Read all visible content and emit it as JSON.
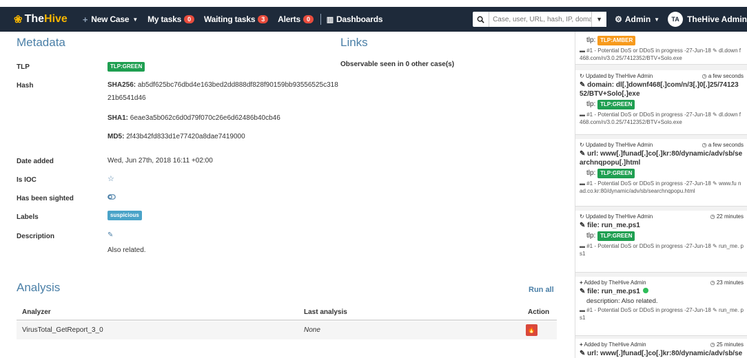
{
  "navbar": {
    "brand_prefix": "The",
    "brand_hive": "Hive",
    "new_case": "New Case",
    "my_tasks": "My tasks",
    "my_tasks_count": "0",
    "waiting_tasks": "Waiting tasks",
    "waiting_tasks_count": "3",
    "alerts": "Alerts",
    "alerts_count": "0",
    "dashboards": "Dashboards",
    "search_placeholder": "Case, user, URL, hash, IP, domain ...",
    "admin": "Admin",
    "avatar_initials": "TA",
    "user_name": "TheHive Admin"
  },
  "metadata": {
    "title": "Metadata",
    "tlp_label": "TLP",
    "tlp_value": "TLP:GREEN",
    "hash_label": "Hash",
    "sha256_label": "SHA256:",
    "sha256_value_1": "ab5df625bc76dbd4e163bed2dd888df828f90159bb93556525c318",
    "sha256_value_2": "21b6541d46",
    "sha1_label": "SHA1:",
    "sha1_value": "6eae3a5b062c6d0d79f070c26e6d62486b40cb46",
    "md5_label": "MD5:",
    "md5_value": "2f43b42fd833d1e77420a8dae7419000",
    "date_label": "Date added",
    "date_value": "Wed, Jun 27th, 2018 16:11 +02:00",
    "ioc_label": "Is IOC",
    "sighted_label": "Has been sighted",
    "labels_label": "Labels",
    "label_value": "suspicious",
    "description_label": "Description",
    "description_value": "Also related."
  },
  "links": {
    "title": "Links",
    "text": "Observable seen in 0 other case(s)"
  },
  "analysis": {
    "title": "Analysis",
    "run_all": "Run all",
    "col_analyzer": "Analyzer",
    "col_last": "Last analysis",
    "col_action": "Action",
    "rows": [
      {
        "analyzer": "VirusTotal_GetReport_3_0",
        "last": "None"
      }
    ]
  },
  "sidebar": {
    "cards": [
      {
        "tlp_prefix": "tlp:",
        "tlp": "TLP:AMBER",
        "case": "#1 - Potential DoS or DDoS in progress -27-Jun-18",
        "extra": "dl.down f468.com/n/3.0.25/7412352/BTV+Solo.exe"
      },
      {
        "head": "Updated by TheHive Admin",
        "time": "a few seconds",
        "title": "domain: dl[.]downf468[.]com/n/3[.]0[.]25/74123 52/BTV+Solo[.]exe",
        "tlp_prefix": "tlp:",
        "tlp": "TLP:GREEN",
        "case": "#1 - Potential DoS or DDoS in progress -27-Jun-18",
        "extra": "dl.down f468.com/n/3.0.25/7412352/BTV+Solo.exe"
      },
      {
        "head": "Updated by TheHive Admin",
        "time": "a few seconds",
        "title": "url: www[.]funad[.]co[.]kr:80/dynamic/adv/sb/se archnqpopu[.]html",
        "tlp_prefix": "tlp:",
        "tlp": "TLP:GREEN",
        "case": "#1 - Potential DoS or DDoS in progress -27-Jun-18",
        "extra": "www.fu nad.co.kr:80/dynamic/adv/sb/searchnqpopu.html"
      },
      {
        "head": "Updated by TheHive Admin",
        "time": "22 minutes",
        "title": "file: run_me.ps1",
        "tlp_prefix": "tlp:",
        "tlp": "TLP:GREEN",
        "case": "#1 - Potential DoS or DDoS in progress -27-Jun-18",
        "extra": "run_me. ps1"
      },
      {
        "head": "Added by TheHive Admin",
        "time": "23 minutes",
        "title": "file: run_me.ps1",
        "desc": "description: Also related.",
        "case": "#1 - Potential DoS or DDoS in progress -27-Jun-18",
        "extra": "run_me. ps1"
      },
      {
        "head": "Added by TheHive Admin",
        "time": "25 minutes",
        "title": "url: www[.]funad[.]co[.]kr:80/dynamic/adv/sb/se"
      }
    ]
  }
}
